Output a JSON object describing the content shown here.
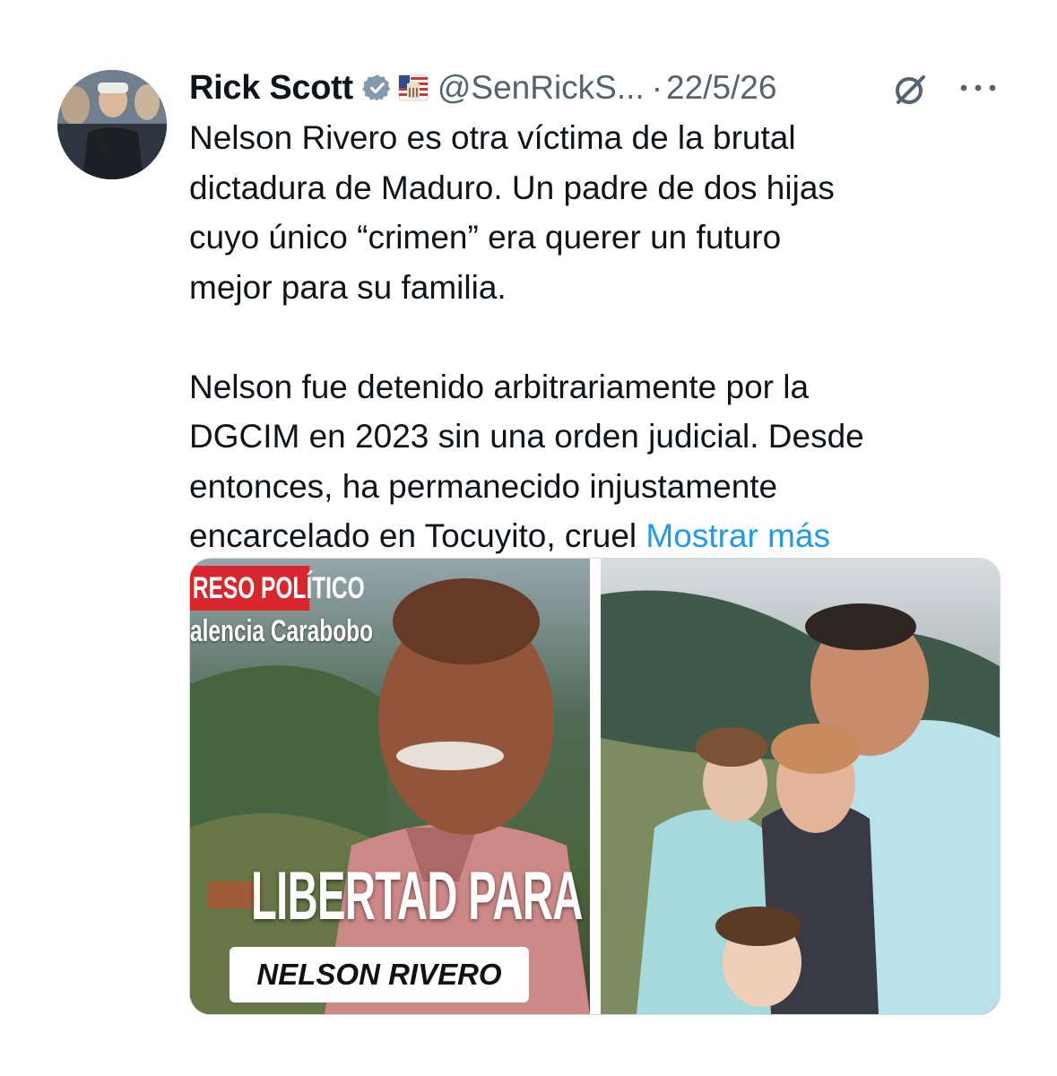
{
  "author": {
    "name": "Rick Scott",
    "handle": "@SenRickS...",
    "separator": "·",
    "date": "22/5/26",
    "verified_icon": "verified-badge-icon",
    "emoji_icon": "us-capitol-flag-icon"
  },
  "tweet": {
    "paragraph1": [
      "Nelson Rivero es otra víctima de la brutal",
      "dictadura de Maduro. Un padre de dos hijas",
      "cuyo único “crimen” era querer un futuro",
      "mejor para su familia."
    ],
    "paragraph2": [
      "Nelson fue detenido arbitrariamente por la",
      "DGCIM en 2023 sin una orden judicial. Desde",
      "entonces, ha permanecido injustamente"
    ],
    "last_line_text": "encarcelado en Tocuyito, cruel ",
    "show_more": "Mostrar más"
  },
  "actions": {
    "grok_icon": "grok-icon",
    "more_icon": "more-options-icon"
  },
  "media": {
    "left": {
      "tag": "RESO POLÍTICO",
      "location": "alencia Carabobo",
      "headline": "LIBERTAD PARA",
      "name": "NELSON RIVERO"
    },
    "right": {
      "description_icon": "family-photo"
    }
  },
  "colors": {
    "link": "#1d9bf0",
    "secondary_text": "#536471",
    "red_tag": "#d9262c"
  }
}
